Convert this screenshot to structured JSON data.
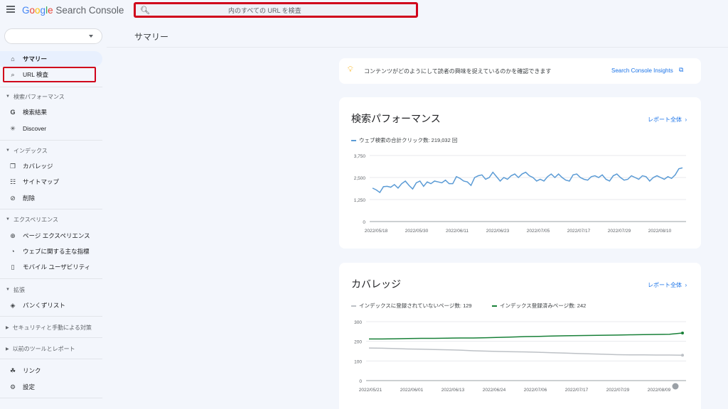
{
  "app": {
    "logo": "Google Search Console",
    "search_placeholder": "内のすべての URL を検査",
    "page_title": "サマリー"
  },
  "sidebar": {
    "items": [
      {
        "label": "サマリー",
        "icon": "home-icon"
      },
      {
        "label": "URL 検査",
        "icon": "search-icon"
      }
    ],
    "sections": [
      {
        "title": "検索パフォーマンス",
        "items": [
          {
            "label": "検索結果",
            "icon": "google-g-icon"
          },
          {
            "label": "Discover",
            "icon": "asterisk-icon"
          }
        ]
      },
      {
        "title": "インデックス",
        "items": [
          {
            "label": "カバレッジ",
            "icon": "pages-icon"
          },
          {
            "label": "サイトマップ",
            "icon": "sitemap-icon"
          },
          {
            "label": "削除",
            "icon": "eye-off-icon"
          }
        ]
      },
      {
        "title": "エクスペリエンス",
        "items": [
          {
            "label": "ページ エクスペリエンス",
            "icon": "plus-circle-icon"
          },
          {
            "label": "ウェブに関する主な指標",
            "icon": "speed-icon"
          },
          {
            "label": "モバイル ユーザビリティ",
            "icon": "phone-icon"
          }
        ]
      },
      {
        "title": "拡張",
        "items": [
          {
            "label": "パンくずリスト",
            "icon": "layers-icon"
          }
        ]
      },
      {
        "title": "セキュリティと手動による対策",
        "items": []
      },
      {
        "title": "以前のツールとレポート",
        "items": []
      }
    ],
    "bottom": [
      {
        "label": "リンク",
        "icon": "network-icon"
      },
      {
        "label": "設定",
        "icon": "gear-icon"
      }
    ]
  },
  "insights": {
    "text": "コンテンツがどのようにして読者の興味を捉えているのかを確認できます",
    "link": "Search Console Insights"
  },
  "performance": {
    "title": "検索パフォーマンス",
    "report_link": "レポート全体",
    "legend": "ウェブ検索の合計クリック数: 219,032 回"
  },
  "coverage": {
    "title": "カバレッジ",
    "report_link": "レポート全体",
    "legend_not_indexed": "インデックスに登録されていないページ数: 129",
    "legend_indexed": "インデックス登録済みページ数: 242"
  },
  "colors": {
    "accent": "#1a73e8",
    "perf_line": "#5b9bd5",
    "indexed": "#188038",
    "not_indexed": "#bdc1c6",
    "highlight_box": "#d0021b"
  },
  "chart_data": [
    {
      "type": "line",
      "title": "検索パフォーマンス",
      "x_ticks": [
        "2022/05/18",
        "2022/05/30",
        "2022/06/11",
        "2022/06/23",
        "2022/07/05",
        "2022/07/17",
        "2022/07/29",
        "2022/08/10"
      ],
      "y_ticks": [
        "3,750",
        "2,500",
        "1,250",
        "0"
      ],
      "ylim": [
        0,
        3750
      ],
      "series": [
        {
          "name": "ウェブ検索の合計クリック数: 219,032 回",
          "values": [
            1900,
            1800,
            1650,
            1980,
            2000,
            1950,
            2100,
            1900,
            2150,
            2300,
            2050,
            1850,
            2200,
            2300,
            2000,
            2250,
            2150,
            2300,
            2250,
            2200,
            2350,
            2150,
            2150,
            2550,
            2450,
            2300,
            2250,
            2050,
            2500,
            2600,
            2650,
            2400,
            2500,
            2800,
            2550,
            2300,
            2500,
            2400,
            2600,
            2700,
            2500,
            2700,
            2800,
            2600,
            2500,
            2300,
            2400,
            2300,
            2550,
            2700,
            2500,
            2700,
            2500,
            2350,
            2300,
            2650,
            2700,
            2500,
            2400,
            2350,
            2550,
            2600,
            2500,
            2650,
            2400,
            2300,
            2600,
            2700,
            2500,
            2350,
            2400,
            2600,
            2500,
            2400,
            2600,
            2550,
            2300,
            2500,
            2600,
            2500,
            2400,
            2550,
            2450,
            2650,
            3000,
            3050
          ]
        }
      ]
    },
    {
      "type": "line",
      "title": "カバレッジ",
      "x_ticks": [
        "2022/05/21",
        "2022/06/01",
        "2022/06/13",
        "2022/06/24",
        "2022/07/06",
        "2022/07/17",
        "2022/07/29",
        "2022/08/09"
      ],
      "y_ticks": [
        "300",
        "200",
        "100",
        "0"
      ],
      "ylim": [
        0,
        300
      ],
      "series": [
        {
          "name": "インデックスに登録されていないページ数: 129",
          "values": [
            166,
            165,
            163,
            161,
            160,
            158,
            157,
            155,
            152,
            150,
            148,
            147,
            146,
            144,
            142,
            140,
            138,
            136,
            134,
            132,
            131,
            131,
            130,
            130,
            129
          ]
        },
        {
          "name": "インデックス登録済みページ数: 242",
          "values": [
            212,
            212,
            213,
            214,
            215,
            215,
            216,
            217,
            217,
            218,
            220,
            222,
            224,
            225,
            227,
            228,
            229,
            230,
            231,
            232,
            233,
            234,
            235,
            236,
            242
          ]
        }
      ]
    }
  ]
}
